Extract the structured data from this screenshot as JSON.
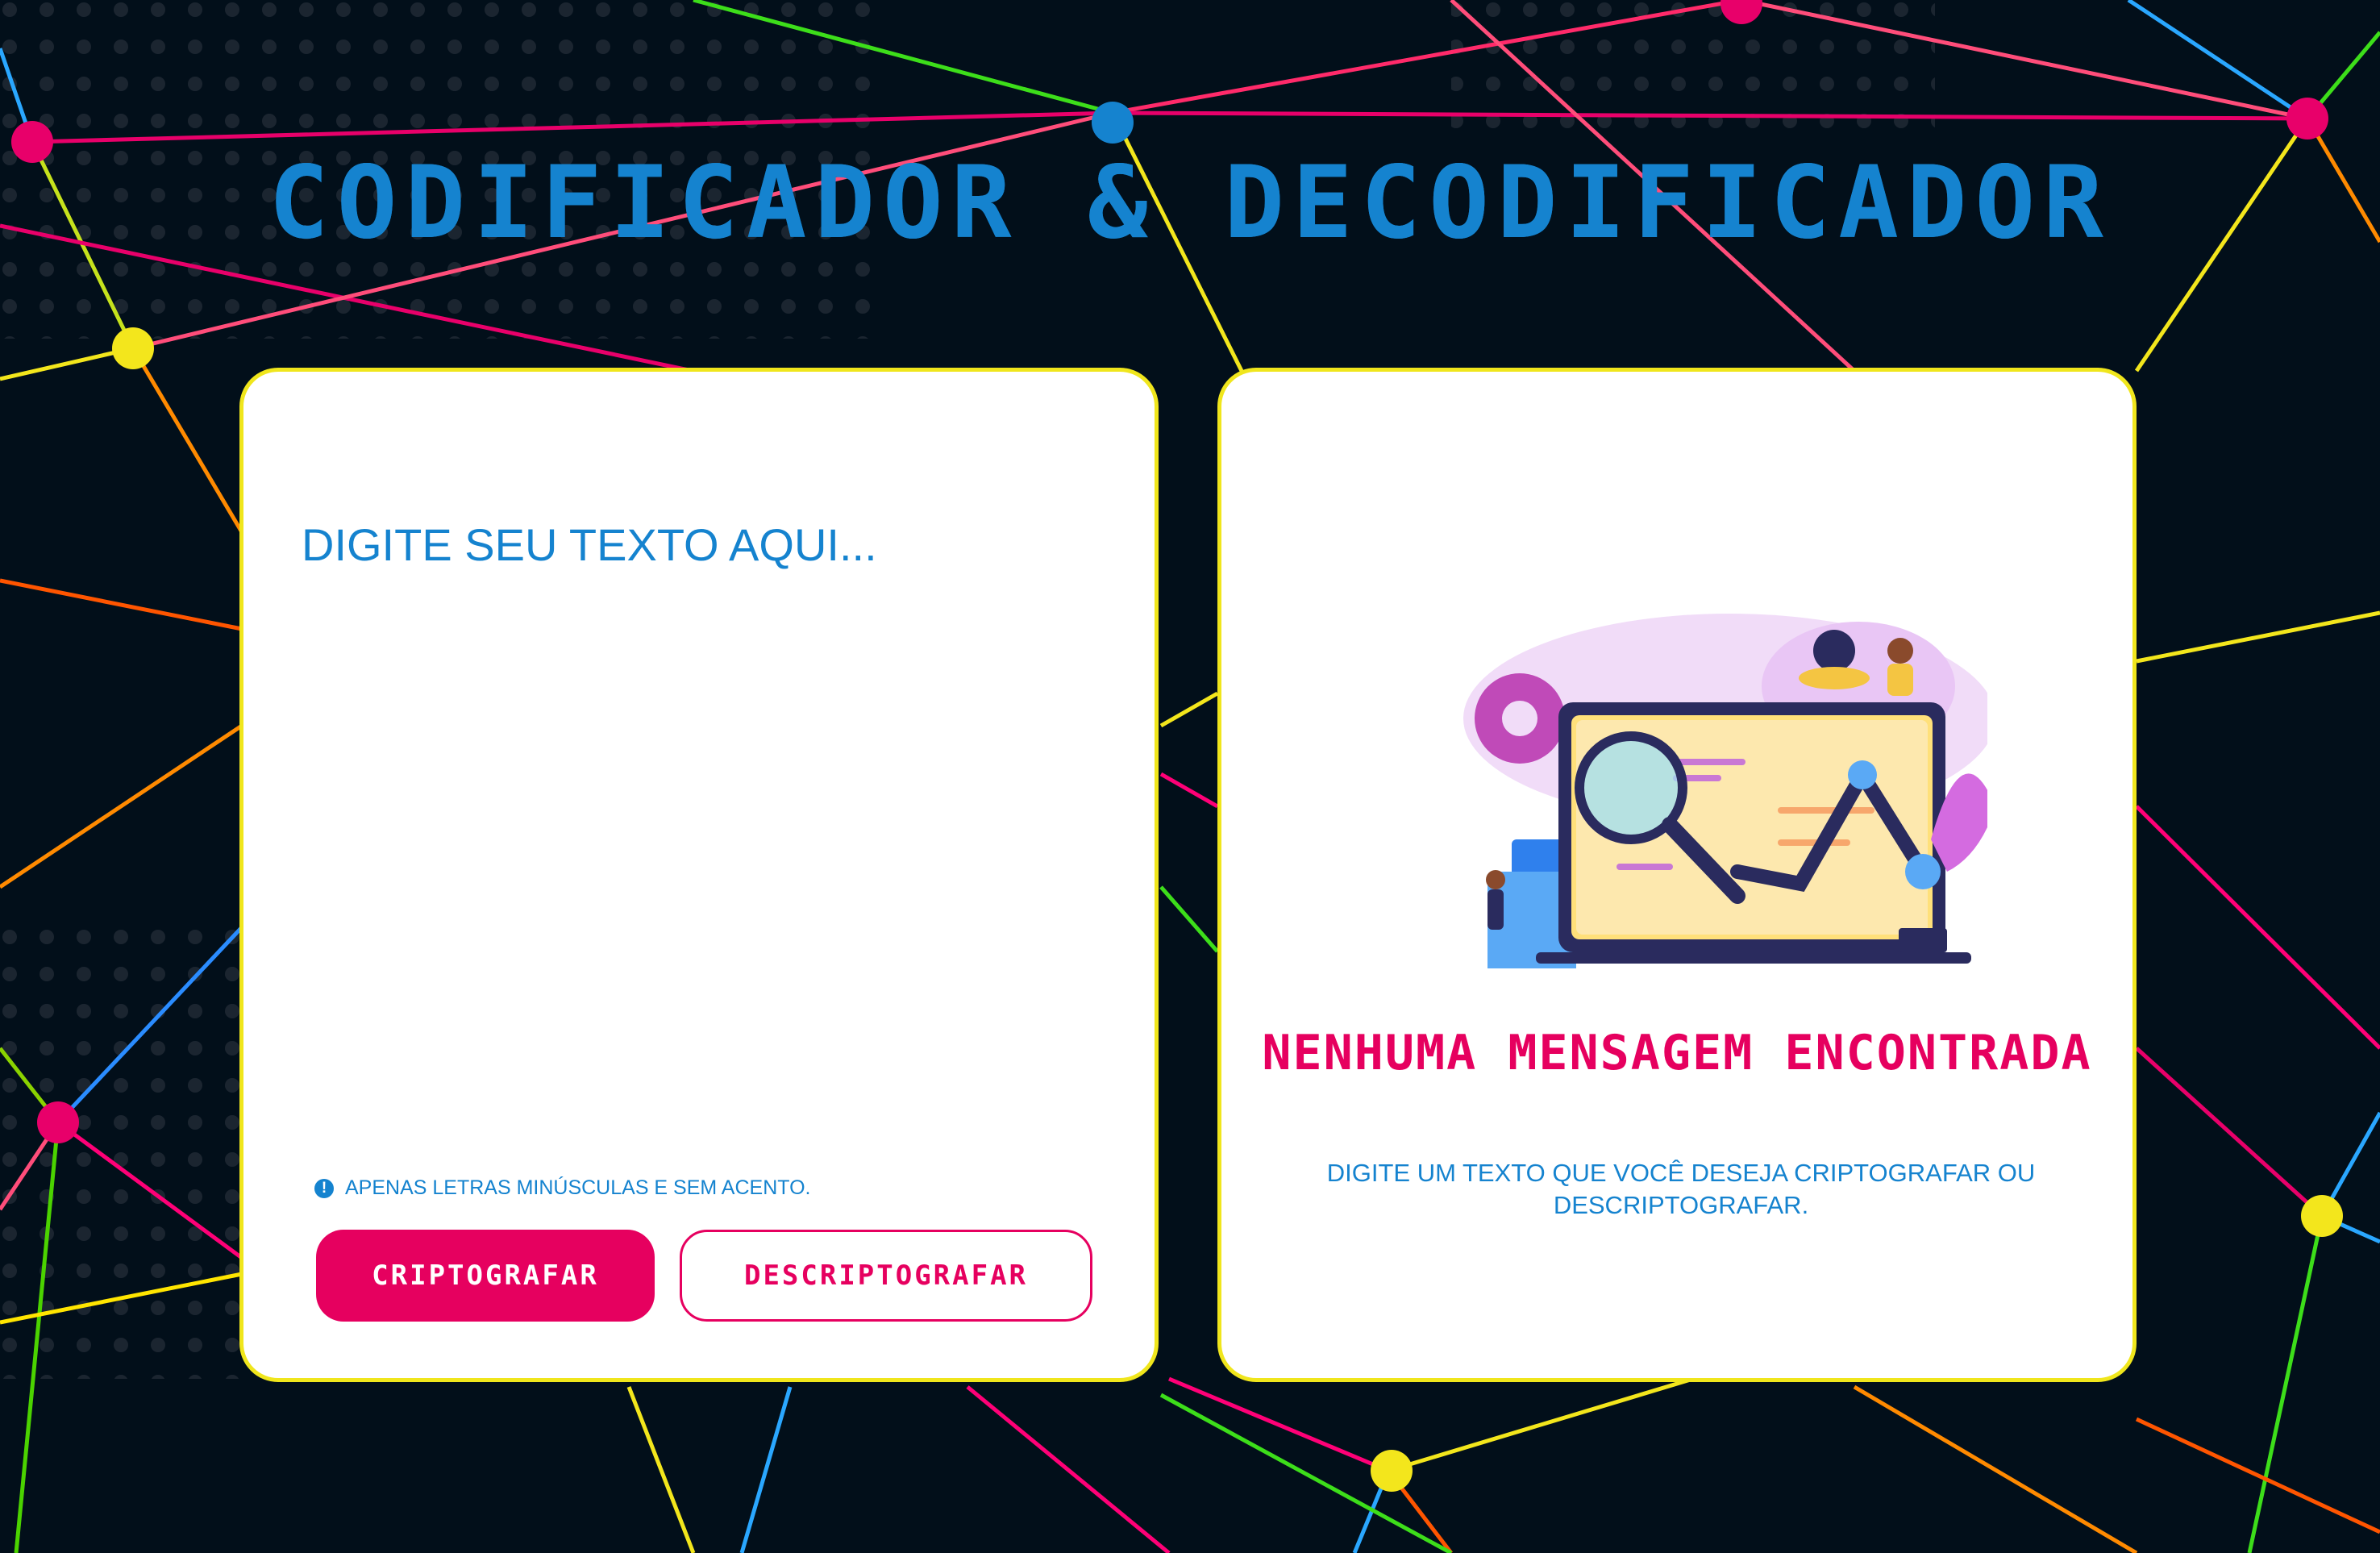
{
  "header": {
    "title": "CODIFICADOR & DECODIFICADOR"
  },
  "editor": {
    "placeholder": "DIGITE SEU TEXTO AQUI...",
    "hint_icon": "exclamation-circle-icon",
    "hint": "APENAS LETRAS MINÚSCULAS E SEM ACENTO.",
    "encrypt_label": "CRIPTOGRAFAR",
    "decrypt_label": "DESCRIPTOGRAFAR"
  },
  "output": {
    "title": "NENHUMA MENSAGEM ENCONTRADA",
    "message": "DIGITE UM TEXTO QUE VOCÊ DESEJA CRIPTOGRAFAR OU DESCRIPTOGRAFAR."
  },
  "colors": {
    "background": "#020f1a",
    "primary_blue": "#1583cf",
    "accent_pink": "#e6005f",
    "card_border": "#f0e61c"
  }
}
